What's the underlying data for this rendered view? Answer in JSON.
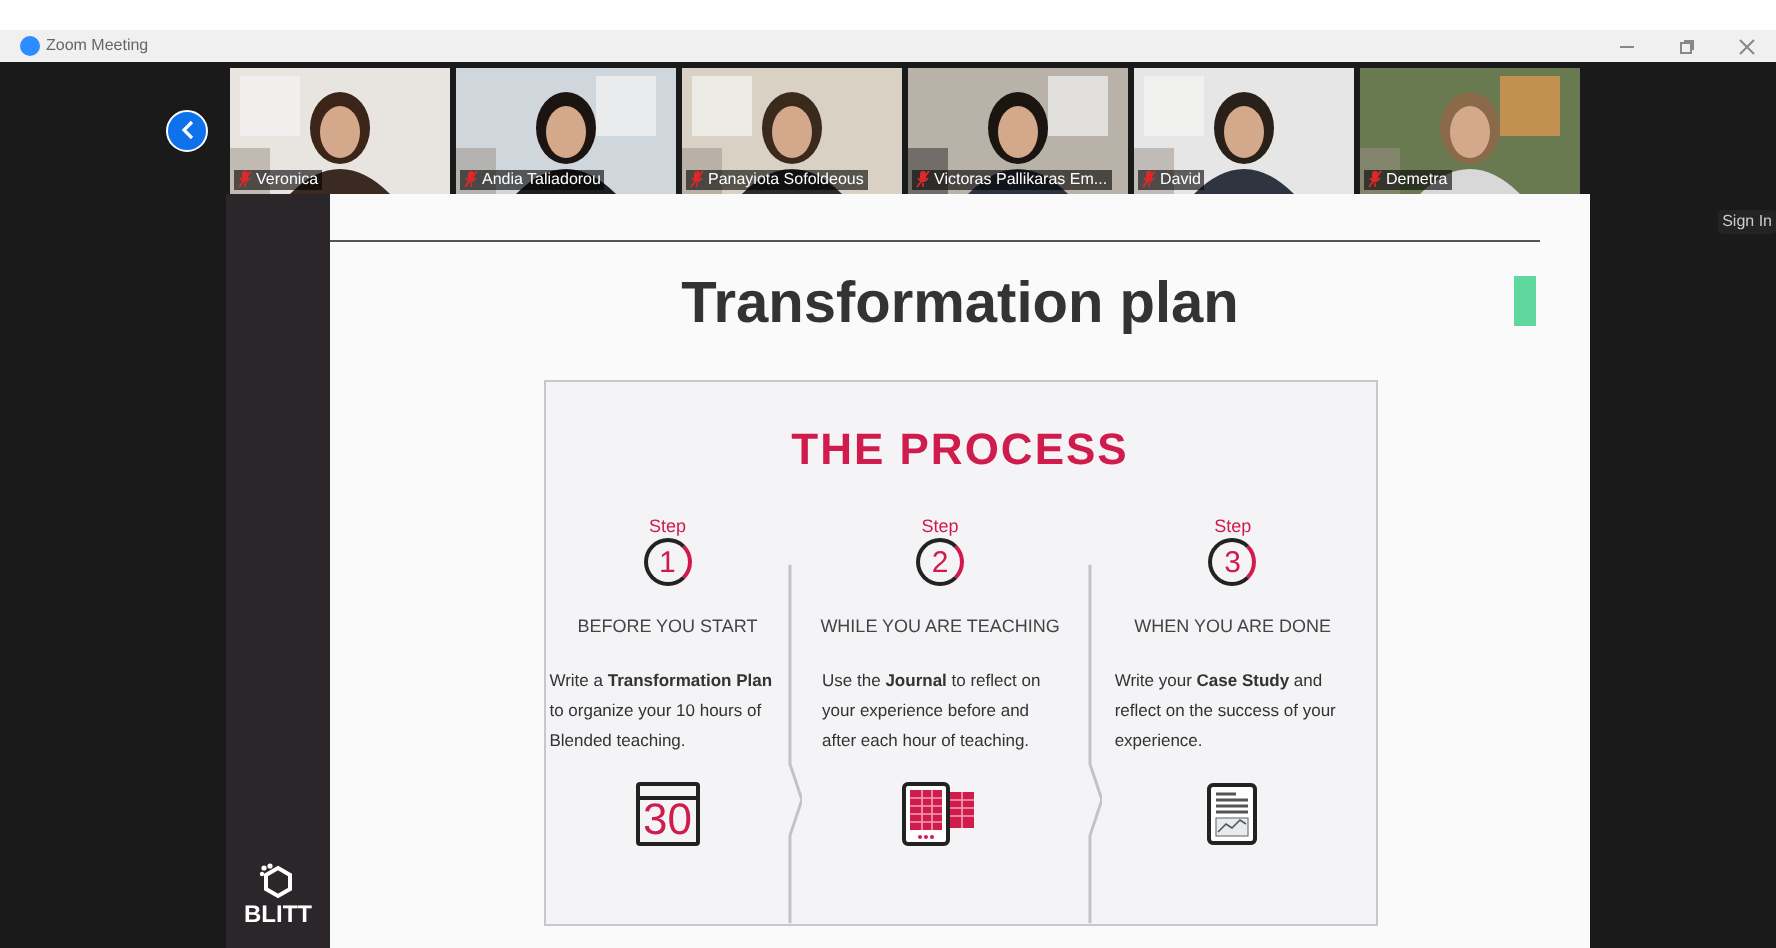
{
  "window": {
    "title": "Zoom Meeting"
  },
  "participants": [
    {
      "name": "Veronica",
      "muted": true
    },
    {
      "name": "Andia Taliadorou",
      "muted": true
    },
    {
      "name": "Panayiota Sofoldeous",
      "muted": true
    },
    {
      "name": "Victoras Pallikaras  Em...",
      "muted": true
    },
    {
      "name": "David",
      "muted": true
    },
    {
      "name": "Demetra",
      "muted": true
    }
  ],
  "sign_in": "Sign In",
  "logo": {
    "text": "BLITT"
  },
  "slide": {
    "title": "Transformation plan",
    "process_title": "THE PROCESS",
    "steps": [
      {
        "label": "Step",
        "number": "1",
        "heading": "BEFORE YOU START",
        "body": "Write a **Transformation Plan** to organize your 10 hours of Blended teaching.",
        "kind": "calendar",
        "icon_text": "30"
      },
      {
        "label": "Step",
        "number": "2",
        "heading": "WHILE YOU ARE TEACHING",
        "body": "Use the **Journal** to reflect on your experience before and after each hour of teaching.",
        "kind": "tablet"
      },
      {
        "label": "Step",
        "number": "3",
        "heading": "WHEN YOU ARE DONE",
        "body": "Write your **Case Study** and reflect on the success of your experience.",
        "kind": "report"
      }
    ]
  }
}
